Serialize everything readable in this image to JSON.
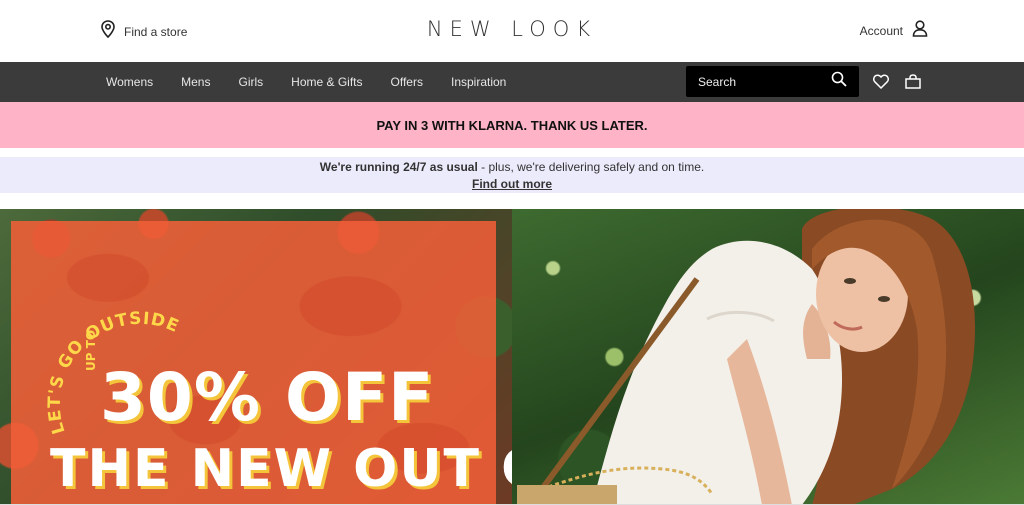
{
  "header": {
    "find_store": "Find a store",
    "logo": "NEW LOOK",
    "account": "Account",
    "icons": {
      "location": "map-pin-icon",
      "account": "user-icon"
    }
  },
  "nav": {
    "items": [
      {
        "label": "Womens"
      },
      {
        "label": "Mens"
      },
      {
        "label": "Girls"
      },
      {
        "label": "Home & Gifts"
      },
      {
        "label": "Offers"
      },
      {
        "label": "Inspiration"
      }
    ],
    "search_placeholder": "Search",
    "icons": {
      "search": "search-icon",
      "wishlist": "heart-icon",
      "bag": "bag-icon"
    }
  },
  "banners": {
    "klarna": "PAY IN 3 WITH KLARNA. THANK US LATER.",
    "info_bold": "We're running 24/7 as usual",
    "info_rest": " - plus, we're delivering safely and on time.",
    "info_link": "Find out more"
  },
  "hero": {
    "tagline": "LET'S GO OUTSIDE",
    "upto": "UP TO",
    "offer": "30% OFF",
    "subtitle": "THE NEW OUT OUT"
  },
  "colors": {
    "nav_bg": "#3b3b3b",
    "klarna_bg": "#ffb3c7",
    "info_bg": "#ecebfb",
    "promo_orange": "#f05e38",
    "accent_yellow": "#f4c43a"
  }
}
